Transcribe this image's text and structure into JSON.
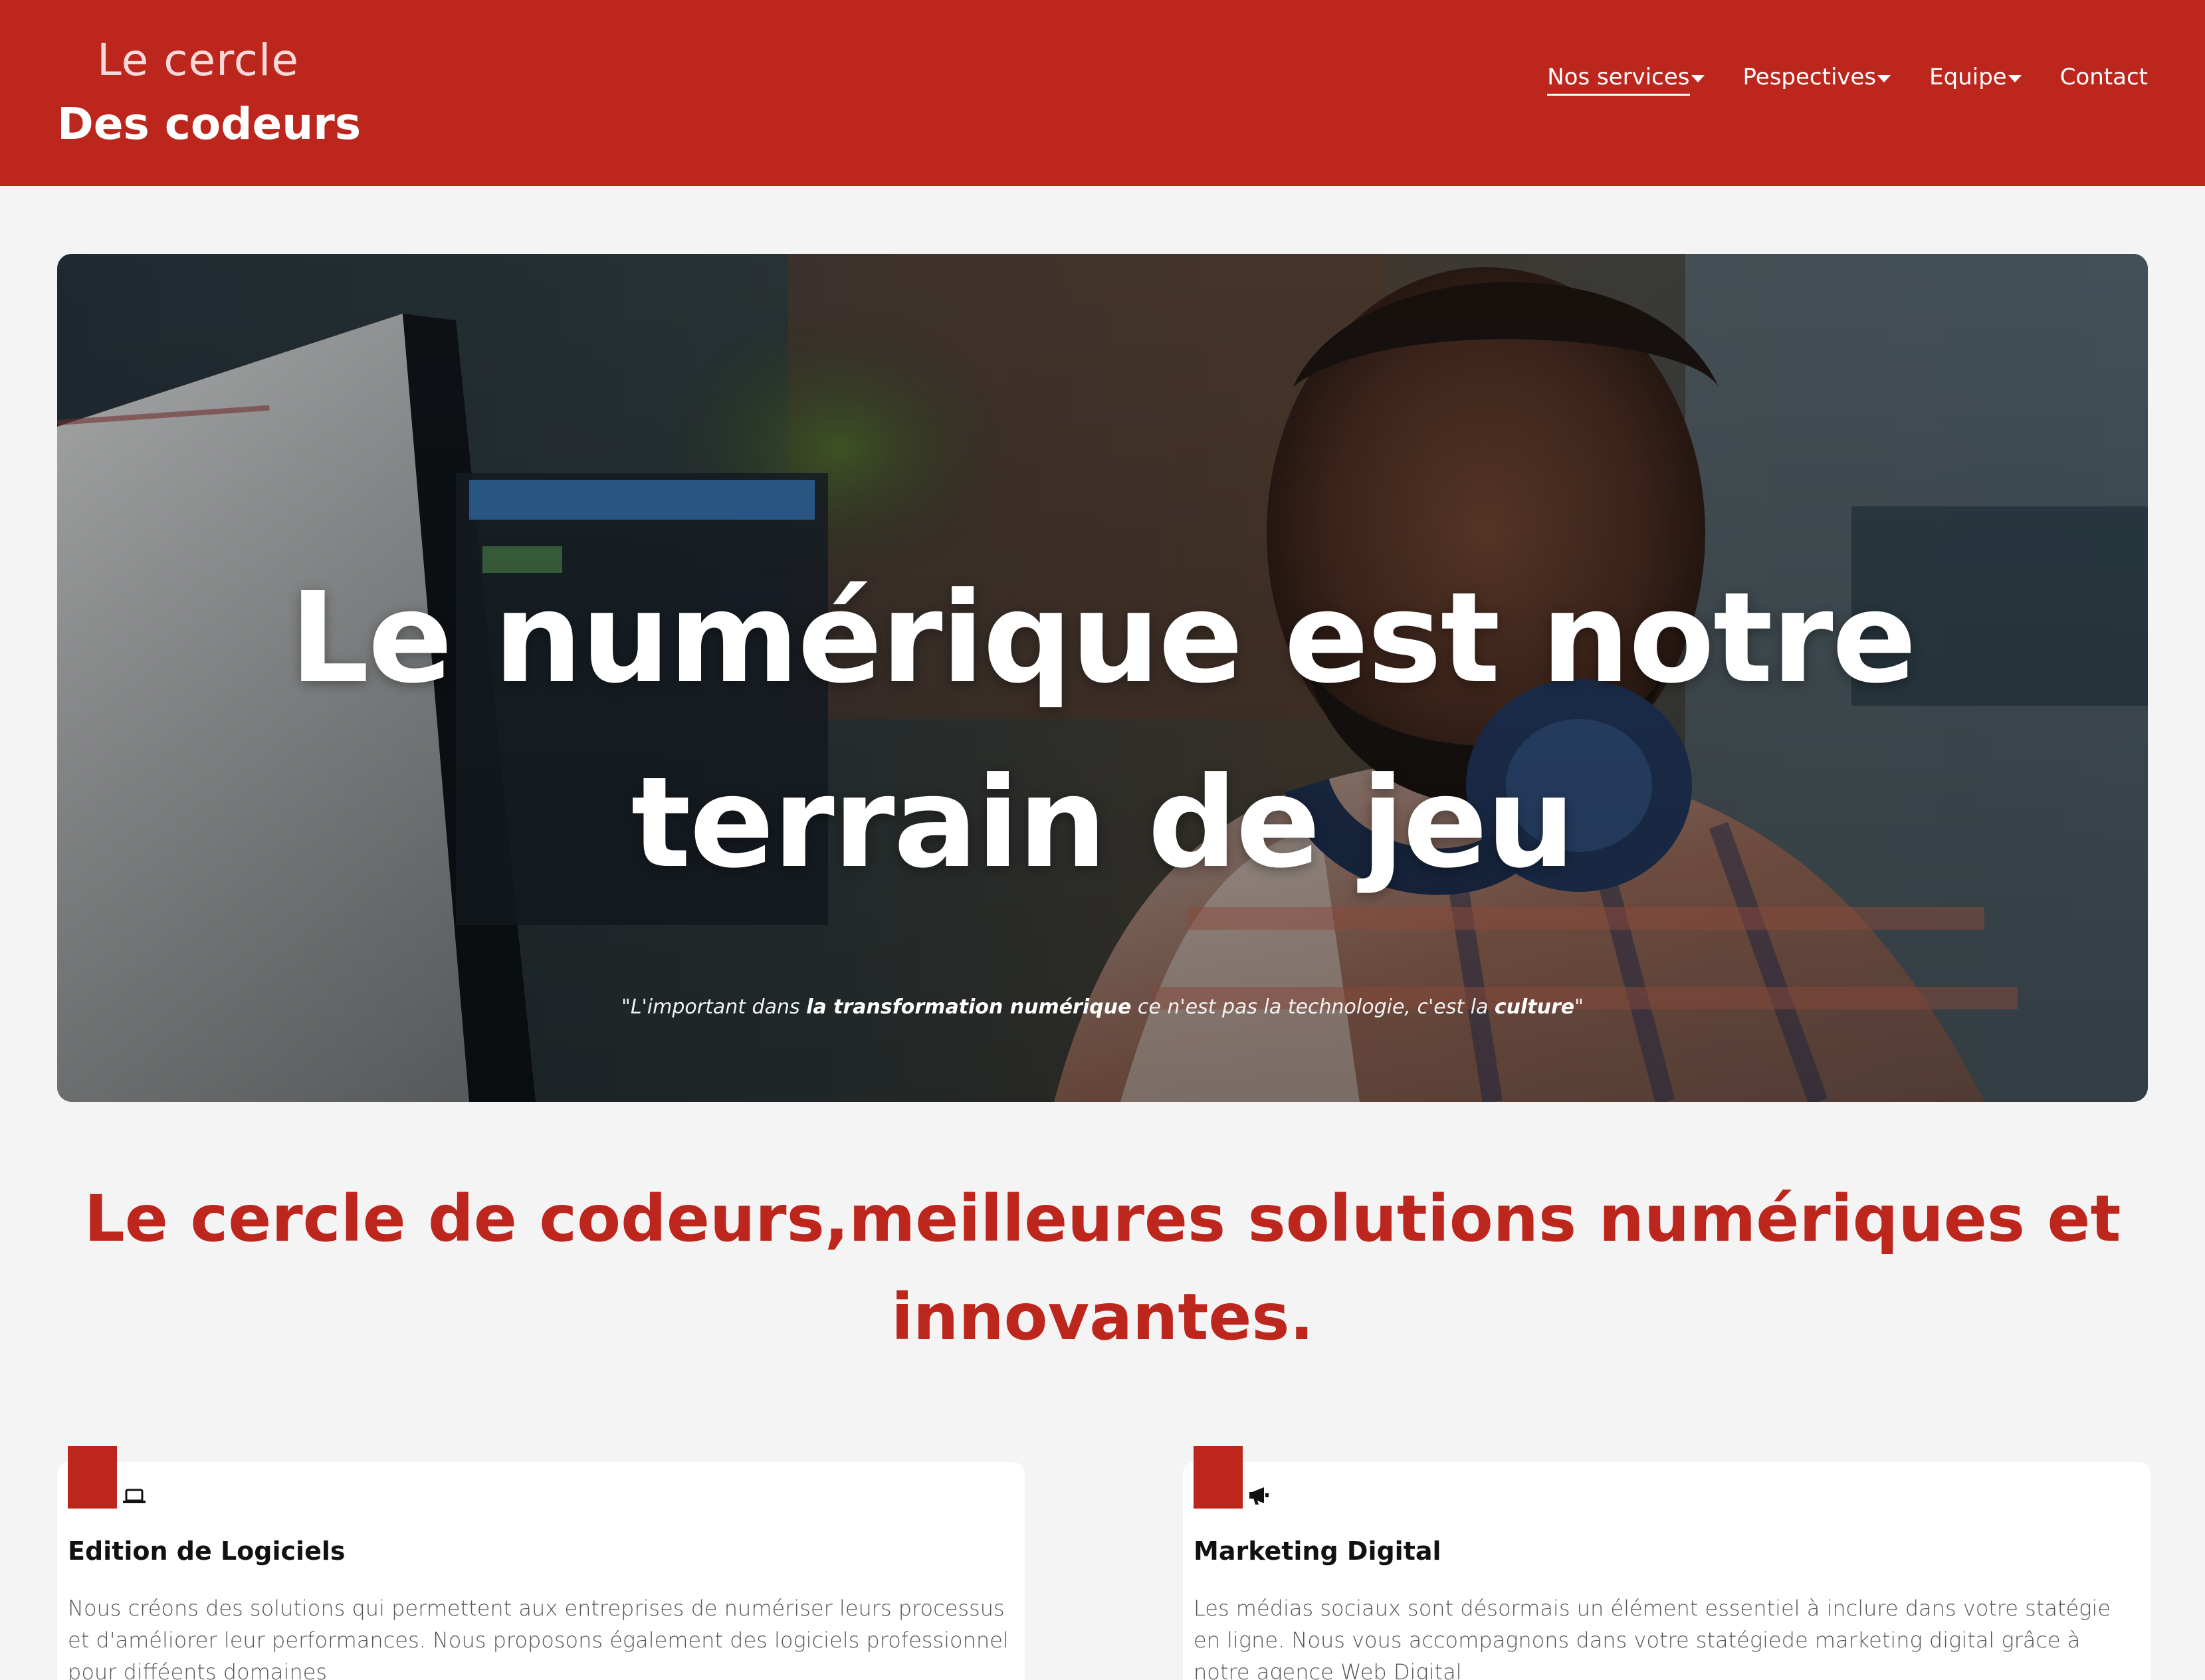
{
  "header": {
    "logo_line1": "Le cercle",
    "logo_line2": "Des codeurs",
    "nav": [
      {
        "label": "Nos services",
        "dropdown": true,
        "active": true
      },
      {
        "label": "Pespectives",
        "dropdown": true,
        "active": false
      },
      {
        "label": "Equipe",
        "dropdown": true,
        "active": false
      },
      {
        "label": "Contact",
        "dropdown": false,
        "active": false
      }
    ]
  },
  "hero": {
    "title": "Le numérique est notre terrain de jeu",
    "quote_part1": "\"L'important dans ",
    "quote_bold1": "la transformation numérique",
    "quote_part2": " ce n'est pas la technologie, c'est la ",
    "quote_bold2": "culture",
    "quote_part3": "\""
  },
  "tagline": "Le cercle de codeurs,meilleures solutions numériques et innovantes.",
  "cards": [
    {
      "icon": "laptop-icon",
      "title": "Edition de Logiciels",
      "text": "Nous créons des solutions qui permettent aux entreprises de numériser leurs processus et d'améliorer leur performances. Nous proposons également des logiciels professionnel pour difféents domaines"
    },
    {
      "icon": "megaphone-icon",
      "title": "Marketing Digital",
      "text": "Les médias sociaux sont désormais un élément essentiel à inclure dans votre statégie en ligne. Nous vous accompagnons dans votre statégiede marketing digital grâce à notre agence Web Digital"
    }
  ],
  "colors": {
    "brand_red": "#bd261d",
    "background": "#f5f4f4",
    "card_background": "#ffffff"
  }
}
